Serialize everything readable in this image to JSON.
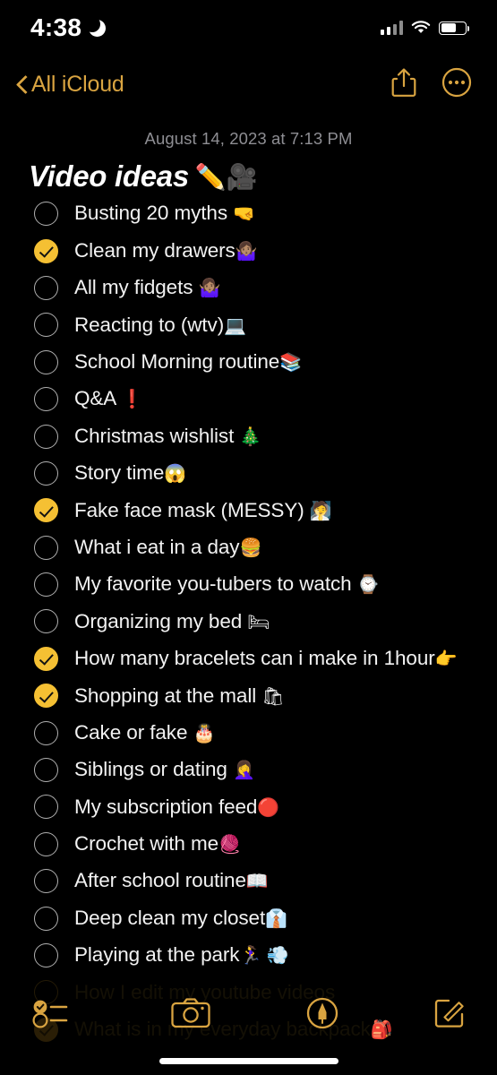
{
  "status_bar": {
    "time": "4:38",
    "do_not_disturb_icon": "crescent-moon-icon",
    "cellular_icon": "cellular-bars-icon",
    "cellular_bars_filled": 2,
    "cellular_bars_total": 4,
    "wifi_icon": "wifi-icon",
    "battery_icon": "battery-icon",
    "battery_percent": 65
  },
  "nav_bar": {
    "back_label": "All iCloud",
    "back_icon": "chevron-left-icon",
    "share_icon": "share-icon",
    "more_icon": "more-circle-icon"
  },
  "note": {
    "date": "August 14, 2023 at 7:13 PM",
    "title": "Video ideas",
    "title_emoji": "✏️🎥",
    "items": [
      {
        "text": "Busting 20 myths ",
        "emoji": "🤜",
        "checked": false,
        "faded": false
      },
      {
        "text": "Clean my drawers",
        "emoji": "🤷🏽‍♀️",
        "checked": true,
        "faded": false
      },
      {
        "text": "All my fidgets ",
        "emoji": "🤷🏽‍♀️",
        "checked": false,
        "faded": false
      },
      {
        "text": "Reacting to (wtv)",
        "emoji": "💻",
        "checked": false,
        "faded": false
      },
      {
        "text": "School Morning routine",
        "emoji": "📚",
        "checked": false,
        "faded": false
      },
      {
        "text": "Q&A ",
        "emoji": "❗",
        "checked": false,
        "faded": false
      },
      {
        "text": "Christmas wishlist ",
        "emoji": "🎄",
        "checked": false,
        "faded": false
      },
      {
        "text": "Story time",
        "emoji": "😱",
        "checked": false,
        "faded": false
      },
      {
        "text": "Fake face mask (MESSY) ",
        "emoji": "🧖",
        "checked": true,
        "faded": false
      },
      {
        "text": "What i eat in a day",
        "emoji": "🍔",
        "checked": false,
        "faded": false
      },
      {
        "text": "My favorite you-tubers to watch ",
        "emoji": "⌚",
        "checked": false,
        "faded": false
      },
      {
        "text": "Organizing my bed ",
        "emoji": "🛏",
        "checked": false,
        "faded": false
      },
      {
        "text": "How many bracelets can i make in 1hour",
        "emoji": "👉",
        "checked": true,
        "faded": false
      },
      {
        "text": "Shopping at the mall ",
        "emoji": "🛍",
        "checked": true,
        "faded": false
      },
      {
        "text": "Cake or fake ",
        "emoji": "🎂",
        "checked": false,
        "faded": false
      },
      {
        "text": "Siblings or dating ",
        "emoji": "🤦‍♀️",
        "checked": false,
        "faded": false
      },
      {
        "text": "My subscription feed",
        "emoji": "🔴",
        "checked": false,
        "faded": false
      },
      {
        "text": "Crochet with me",
        "emoji": "🧶",
        "checked": false,
        "faded": false
      },
      {
        "text": "After school routine",
        "emoji": "📖",
        "checked": false,
        "faded": false
      },
      {
        "text": "Deep clean my closet",
        "emoji": "👔",
        "checked": false,
        "faded": false
      },
      {
        "text": "Playing at the park",
        "emoji": "🏃‍♀️ 💨",
        "checked": false,
        "faded": false
      },
      {
        "text": "How I edit my youtube videos",
        "emoji": "",
        "checked": false,
        "faded": true
      },
      {
        "text": "What is in my everyday backpack",
        "emoji": "🎒",
        "checked": true,
        "faded": true
      }
    ]
  },
  "toolbar": {
    "checklist_icon": "checklist-icon",
    "camera_icon": "camera-icon",
    "markup_icon": "markup-pen-icon",
    "compose_icon": "compose-icon"
  },
  "colors": {
    "accent": "#d9a441",
    "checkbox_checked": "#f5c033",
    "background": "#000000",
    "text": "#f2f2f2",
    "date_text": "#8e8e93"
  }
}
